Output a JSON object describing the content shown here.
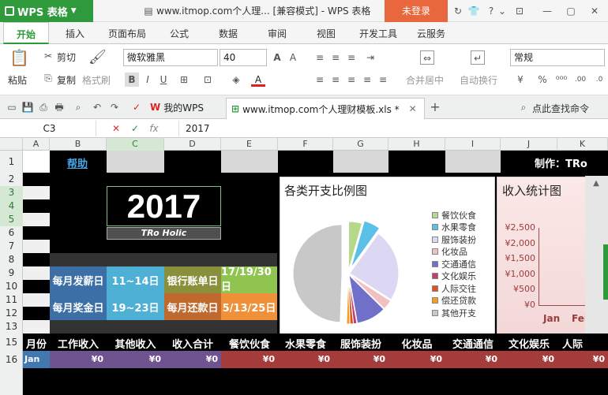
{
  "app": {
    "name": "WPS 表格",
    "doc_title": "www.itmop.com个人理... [兼容模式] - WPS 表格",
    "login": "未登录"
  },
  "tabs": [
    "开始",
    "插入",
    "页面布局",
    "公式",
    "数据",
    "审阅",
    "视图",
    "开发工具",
    "云服务"
  ],
  "ribbon": {
    "cut": "剪切",
    "paste": "粘贴",
    "copy": "复制",
    "format_painter": "格式刷",
    "font_name": "微软雅黑",
    "font_size": "40",
    "merge": "合并居中",
    "wrap": "自动换行",
    "number_format": "常规",
    "bold": "B",
    "italic": "I",
    "underline": "U"
  },
  "doc_tabs": {
    "home": "我的WPS",
    "file": "www.itmop.com个人理财模板.xls *",
    "search": "点此查找命令"
  },
  "formula_bar": {
    "cell_ref": "C3",
    "content": "2017",
    "fx": "fx"
  },
  "columns": [
    "A",
    "B",
    "C",
    "D",
    "E",
    "F",
    "G",
    "H",
    "I",
    "J",
    "K"
  ],
  "rows": [
    "1",
    "2",
    "3",
    "4",
    "5",
    "6",
    "7",
    "8",
    "9",
    "10",
    "11",
    "12",
    "13",
    "15",
    "16"
  ],
  "sheet": {
    "help_link": "帮助",
    "maker": "制作：TRo",
    "year": "2017",
    "year_sub": "TRo Holic",
    "info": [
      {
        "label": "每月发薪日",
        "value": "11~14日",
        "label2": "银行账单日",
        "value2": "17/19/30日"
      },
      {
        "label": "每月奖金日",
        "value": "19~23日",
        "label2": "每月还款日",
        "value2": "5/13/25日"
      }
    ],
    "table_headers": [
      "月份",
      "工作收入",
      "其他收入",
      "收入合计",
      "餐饮伙食",
      "水果零食",
      "服饰装扮",
      "化妆品",
      "交通通信",
      "文化娱乐",
      "人际"
    ],
    "row16": {
      "month": "Jan",
      "values": [
        "¥0",
        "¥0",
        "¥0",
        "¥0",
        "¥0",
        "¥0",
        "¥0",
        "¥0",
        "¥0",
        "¥0"
      ]
    }
  },
  "chart_data": [
    {
      "type": "pie",
      "title": "各类开支比例图",
      "legend": [
        "餐饮伙食",
        "水果零食",
        "服饰装扮",
        "化妆品",
        "交通通信",
        "文化娱乐",
        "人际交往",
        "偿还贷款",
        "其他开支"
      ],
      "colors": [
        "#b5d98a",
        "#5bc0e8",
        "#dcd7f2",
        "#f2c0c0",
        "#7070c8",
        "#c0406a",
        "#e05020",
        "#f0a020",
        "#c8c8c8"
      ],
      "values": [
        4,
        5,
        22,
        3,
        9,
        1,
        1,
        1,
        45
      ]
    },
    {
      "type": "line",
      "title": "收入统计图",
      "y_ticks": [
        "¥2,500",
        "¥2,000",
        "¥1,500",
        "¥1,000",
        "¥500",
        "¥0"
      ],
      "ylim": [
        0,
        2500
      ],
      "categories": [
        "Jan",
        "Feb"
      ]
    }
  ]
}
